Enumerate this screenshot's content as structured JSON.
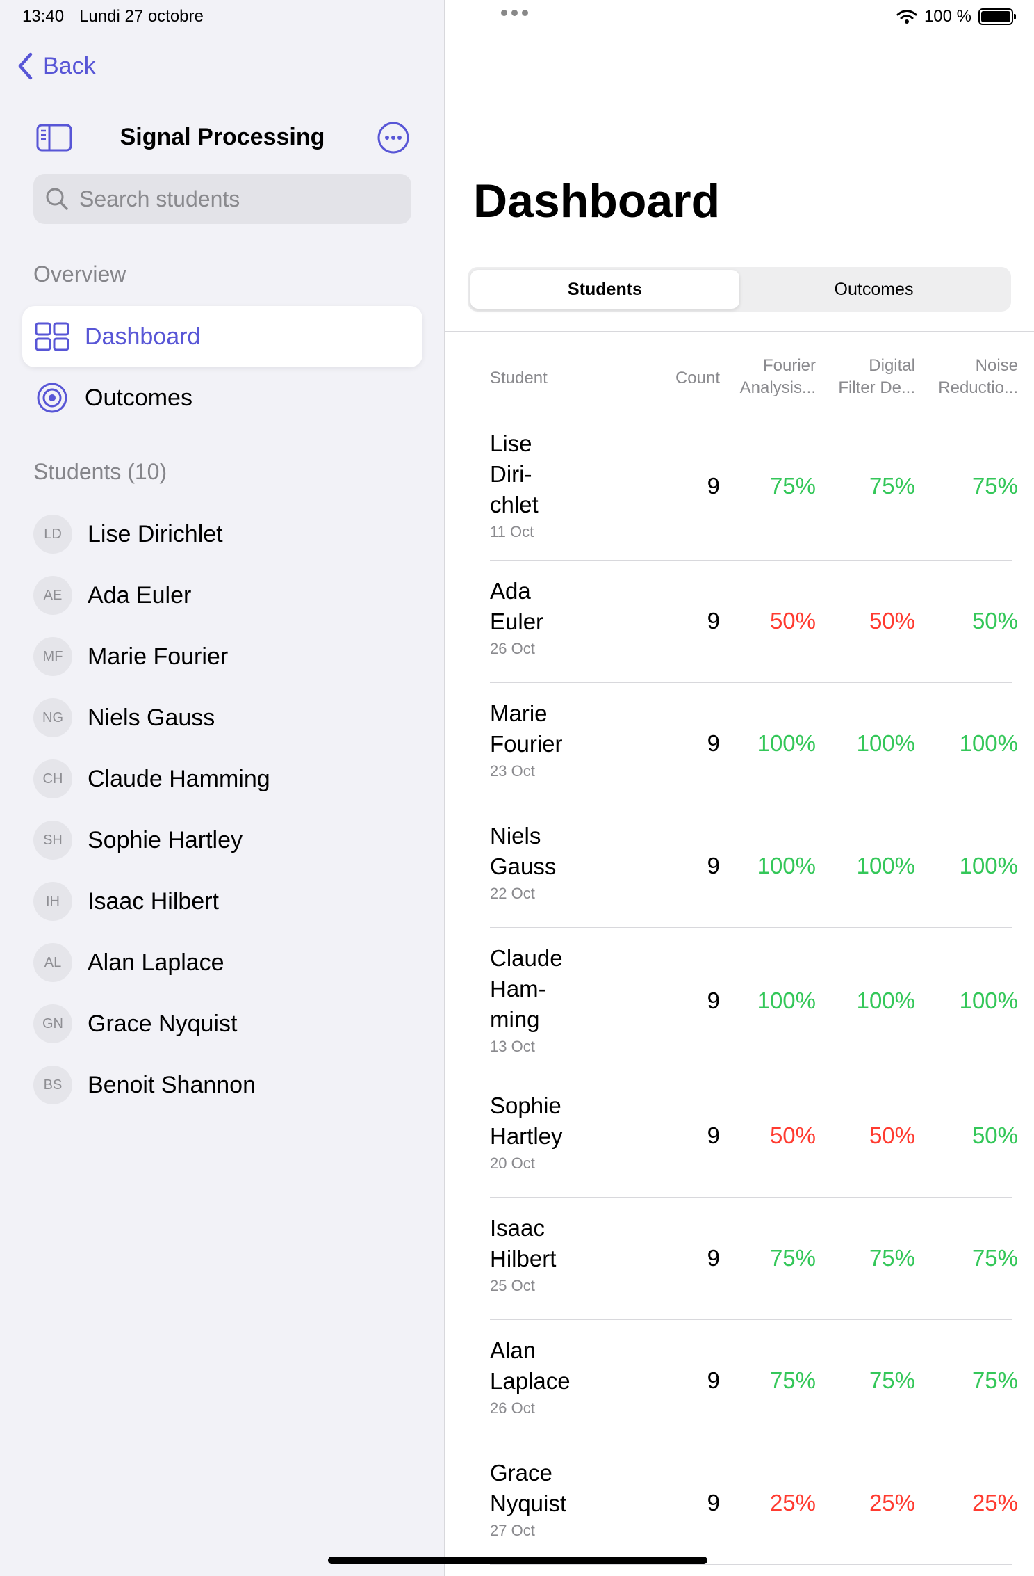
{
  "status": {
    "time": "13:40",
    "date": "Lundi 27 octobre",
    "battery": "100 %"
  },
  "sidebar": {
    "back_label": "Back",
    "title": "Signal Processing",
    "search_placeholder": "Search students",
    "overview_header": "Overview",
    "nav": [
      {
        "label": "Dashboard",
        "icon": "grid-icon",
        "active": true
      },
      {
        "label": "Outcomes",
        "icon": "target-icon",
        "active": false
      }
    ],
    "students_header": "Students (10)",
    "students": [
      {
        "initials": "LD",
        "name": "Lise Dirichlet"
      },
      {
        "initials": "AE",
        "name": "Ada Euler"
      },
      {
        "initials": "MF",
        "name": "Marie Fourier"
      },
      {
        "initials": "NG",
        "name": "Niels Gauss"
      },
      {
        "initials": "CH",
        "name": "Claude Hamming"
      },
      {
        "initials": "SH",
        "name": "Sophie Hartley"
      },
      {
        "initials": "IH",
        "name": "Isaac Hilbert"
      },
      {
        "initials": "AL",
        "name": "Alan Laplace"
      },
      {
        "initials": "GN",
        "name": "Grace Nyquist"
      },
      {
        "initials": "BS",
        "name": "Benoit Shannon"
      }
    ]
  },
  "main": {
    "title": "Dashboard",
    "tabs": [
      {
        "label": "Students",
        "active": true
      },
      {
        "label": "Outcomes",
        "active": false
      }
    ],
    "table": {
      "headers": {
        "student": "Student",
        "count": "Count",
        "c1_line1": "Fourier",
        "c1_line2": "Analysis...",
        "c2_line1": "Digital",
        "c2_line2": "Filter De...",
        "c3_line1": "Noise",
        "c3_line2": "Reductio..."
      },
      "rows": [
        {
          "name_lines": [
            "Lise",
            "Diri-",
            "chlet"
          ],
          "date": "11 Oct",
          "count": "9",
          "c1": "75%",
          "c2": "75%",
          "c3": "75%",
          "c1_status": "good",
          "c2_status": "good",
          "c3_status": "good"
        },
        {
          "name_lines": [
            "Ada",
            "Euler"
          ],
          "date": "26 Oct",
          "count": "9",
          "c1": "50%",
          "c2": "50%",
          "c3": "50%",
          "c1_status": "bad",
          "c2_status": "bad",
          "c3_status": "good"
        },
        {
          "name_lines": [
            "Marie",
            "Fourier"
          ],
          "date": "23 Oct",
          "count": "9",
          "c1": "100%",
          "c2": "100%",
          "c3": "100%",
          "c1_status": "good",
          "c2_status": "good",
          "c3_status": "good"
        },
        {
          "name_lines": [
            "Niels",
            "Gauss"
          ],
          "date": "22 Oct",
          "count": "9",
          "c1": "100%",
          "c2": "100%",
          "c3": "100%",
          "c1_status": "good",
          "c2_status": "good",
          "c3_status": "good"
        },
        {
          "name_lines": [
            "Claude",
            "Ham-",
            "ming"
          ],
          "date": "13 Oct",
          "count": "9",
          "c1": "100%",
          "c2": "100%",
          "c3": "100%",
          "c1_status": "good",
          "c2_status": "good",
          "c3_status": "good"
        },
        {
          "name_lines": [
            "Sophie",
            "Hartley"
          ],
          "date": "20 Oct",
          "count": "9",
          "c1": "50%",
          "c2": "50%",
          "c3": "50%",
          "c1_status": "bad",
          "c2_status": "bad",
          "c3_status": "good"
        },
        {
          "name_lines": [
            "Isaac",
            "Hilbert"
          ],
          "date": "25 Oct",
          "count": "9",
          "c1": "75%",
          "c2": "75%",
          "c3": "75%",
          "c1_status": "good",
          "c2_status": "good",
          "c3_status": "good"
        },
        {
          "name_lines": [
            "Alan",
            "Laplace"
          ],
          "date": "26 Oct",
          "count": "9",
          "c1": "75%",
          "c2": "75%",
          "c3": "75%",
          "c1_status": "good",
          "c2_status": "good",
          "c3_status": "good"
        },
        {
          "name_lines": [
            "Grace",
            "Nyquist"
          ],
          "date": "27 Oct",
          "count": "9",
          "c1": "25%",
          "c2": "25%",
          "c3": "25%",
          "c1_status": "bad",
          "c2_status": "bad",
          "c3_status": "bad"
        }
      ]
    }
  },
  "colors": {
    "accent": "#5856d6",
    "good": "#34c759",
    "bad": "#ff3b30",
    "sidebar_bg": "#f2f2f7"
  }
}
